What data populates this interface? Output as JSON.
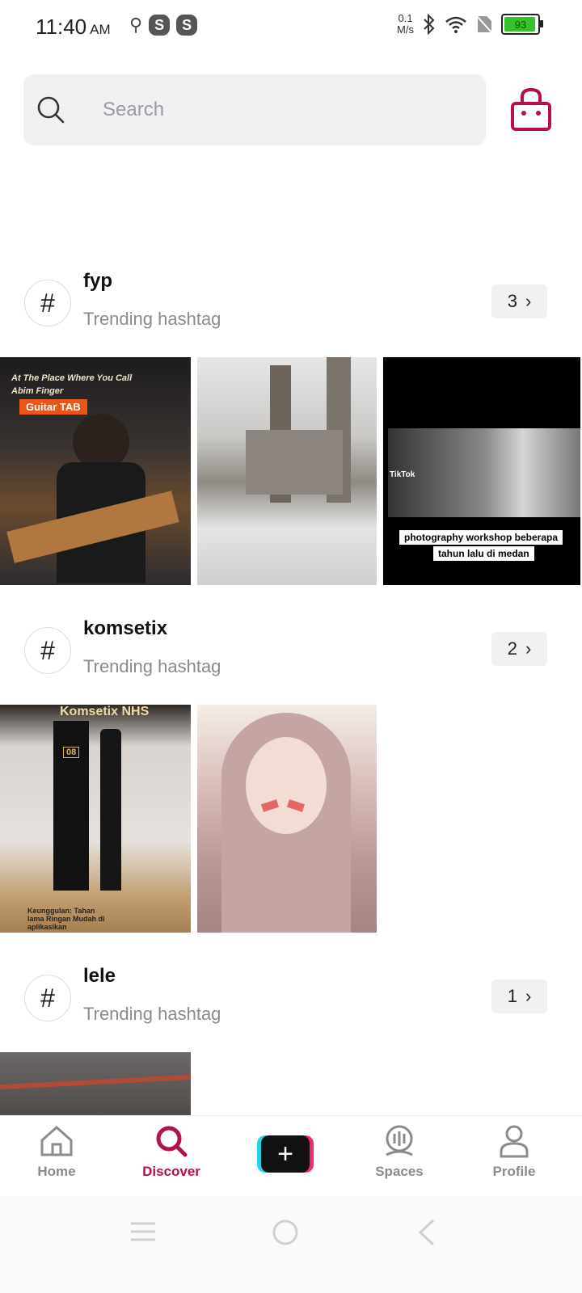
{
  "status": {
    "time": "11:40",
    "ampm": "AM",
    "s1": "S",
    "s2": "S",
    "speed_val": "0.1",
    "speed_unit": "M/s",
    "battery": "93"
  },
  "search": {
    "placeholder": "Search"
  },
  "sections": [
    {
      "tag": "fyp",
      "subtitle": "Trending hashtag",
      "count": "3",
      "captions": {
        "a1": "At The Place Where You Call",
        "a2": "Abim Finger",
        "a3": "Guitar TAB",
        "c1": "photography workshop beberapa",
        "c2": "tahun lalu di medan",
        "c3": "TikTok"
      }
    },
    {
      "tag": "komsetix",
      "subtitle": "Trending hashtag",
      "count": "2",
      "captions": {
        "a1": "Komsetix NHS",
        "a2": "08",
        "a3": "Keunggulan: Tahan lama Ringan Mudah di aplikasikan"
      }
    },
    {
      "tag": "lele",
      "subtitle": "Trending hashtag",
      "count": "1"
    }
  ],
  "tabs": {
    "home": "Home",
    "discover": "Discover",
    "spaces": "Spaces",
    "profile": "Profile"
  },
  "colors": {
    "accent": "#b5104d"
  }
}
